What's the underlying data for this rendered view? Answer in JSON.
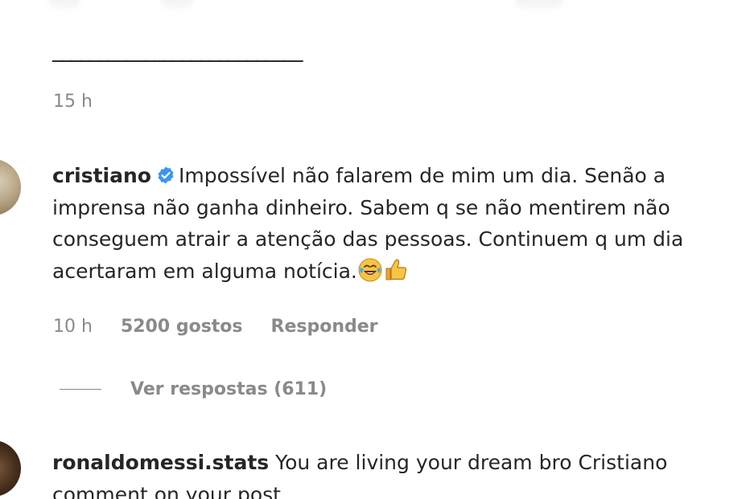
{
  "previous_comment": {
    "underline_text": "___________________________",
    "time": "15 h"
  },
  "main_comment": {
    "username": "cristiano",
    "verified": true,
    "text": "Impossível não falarem de mim um dia. Senão a imprensa não ganha dinheiro. Sabem q se não mentirem não conseguem atrair a atenção das pessoas. Continuem q um dia acertaram em alguma notícia.",
    "emojis": [
      "face-with-tears-of-joy-icon",
      "thumbs-up-icon"
    ],
    "time": "10 h",
    "likes": "5200 gostos",
    "reply_label": "Responder",
    "view_replies_label": "Ver respostas (611)"
  },
  "second_comment": {
    "username": "ronaldomessi.stats",
    "line1": "You are living your dream bro Cristiano",
    "line2": "comment on your post"
  },
  "colors": {
    "text": "#262626",
    "secondary": "#8a8a8a",
    "verified_blue": "#3897f0"
  }
}
